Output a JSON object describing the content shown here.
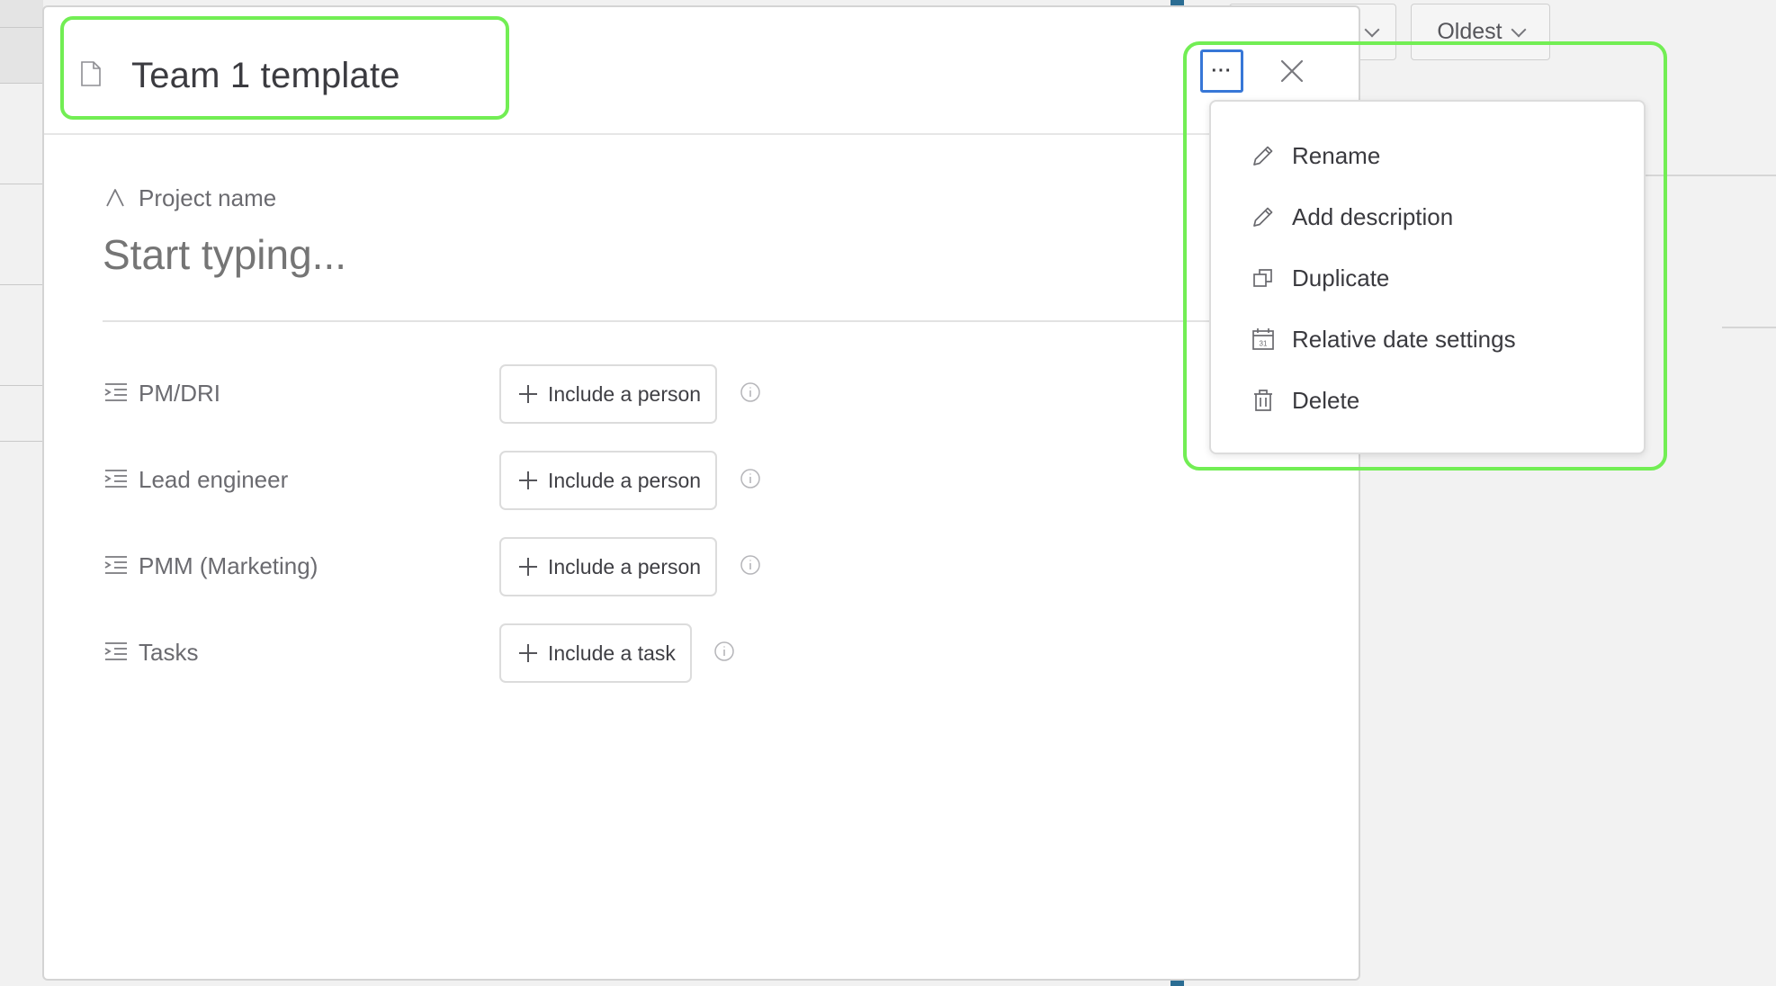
{
  "background": {
    "sort_button_label": "Oldest"
  },
  "modal": {
    "title": "Team 1 template",
    "more_button_label": "···",
    "project_name": {
      "label": "Project name",
      "placeholder": "Start typing..."
    },
    "rows": [
      {
        "label": "PM/DRI",
        "button": "Include a person"
      },
      {
        "label": "Lead engineer",
        "button": "Include a person"
      },
      {
        "label": "PMM (Marketing)",
        "button": "Include a person"
      },
      {
        "label": "Tasks",
        "button": "Include a task"
      }
    ]
  },
  "menu": {
    "items": [
      {
        "label": "Rename",
        "icon": "pencil-icon"
      },
      {
        "label": "Add description",
        "icon": "pencil-icon"
      },
      {
        "label": "Duplicate",
        "icon": "duplicate-icon"
      },
      {
        "label": "Relative date settings",
        "icon": "calendar-icon"
      },
      {
        "label": "Delete",
        "icon": "trash-icon"
      }
    ]
  },
  "colors": {
    "highlight": "#72ee54",
    "focus_ring": "#3777d7",
    "scroll_marker": "#2b6d93"
  }
}
